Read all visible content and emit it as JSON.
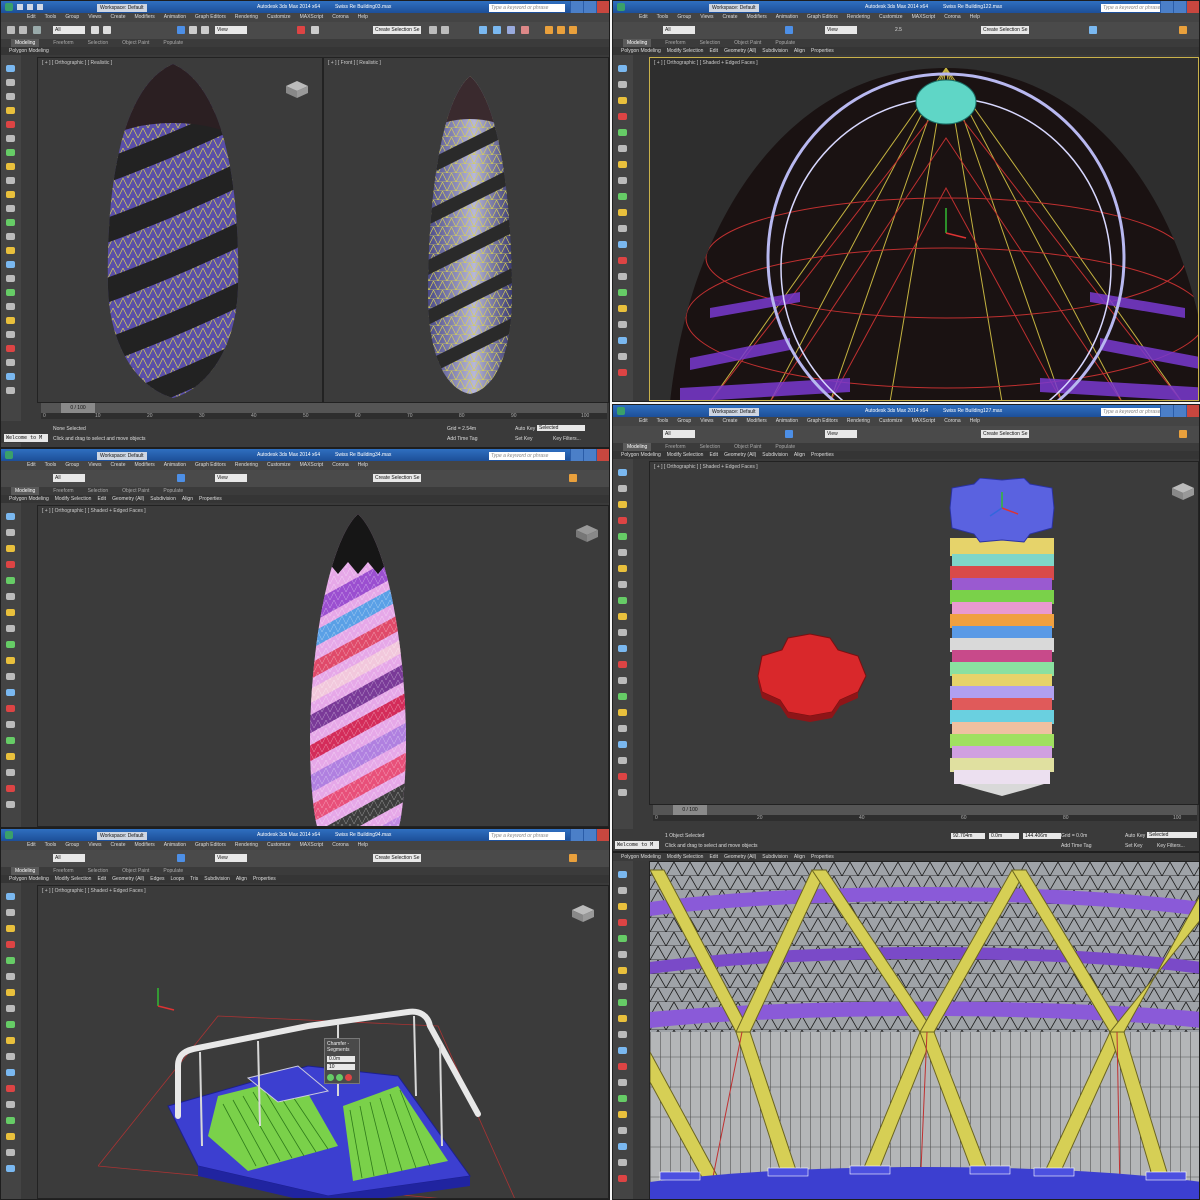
{
  "app": {
    "title": "Autodesk 3ds Max 2014 x64",
    "workspace": "Workspace: Default",
    "search_placeholder": "Type a keyword or phrase"
  },
  "menu": [
    "Edit",
    "Tools",
    "Group",
    "Views",
    "Create",
    "Modifiers",
    "Animation",
    "Graph Editors",
    "Rendering",
    "Customize",
    "MAXScript",
    "Corona",
    "Help"
  ],
  "toolbar": {
    "filter_all": "All",
    "view": "View",
    "create_selection_set": "Create Selection Se",
    "snap": "2.5"
  },
  "ribbon": {
    "tabs": [
      "Modeling",
      "Freeform",
      "Selection",
      "Object Paint",
      "Populate"
    ],
    "sub_default": [
      "Polygon Modeling",
      "Modify Selection",
      "Edit",
      "Geometry (All)",
      "Subdivision",
      "Align",
      "Properties"
    ],
    "sub_edges": [
      "Polygon Modeling",
      "Modify Selection",
      "Edit",
      "Geometry (All)",
      "Edges",
      "Loops",
      "Tris",
      "Subdivision",
      "Align",
      "Properties"
    ]
  },
  "panels": {
    "tl": {
      "file": "Swiss Re Building03.max",
      "vp_left": "[ + ] [ Orthographic ] [ Realistic ]",
      "vp_right": "[ + ] [ Front ] [ Realistic ]",
      "frame": "0 / 100",
      "status_selected": "None Selected",
      "prompt": "Click and drag to select and move objects",
      "grid": "Grid = 2.54m",
      "autokey": "Auto Key",
      "selected": "Selected",
      "setkey": "Set Key",
      "keyfilters": "Key Filters...",
      "add_time_tag": "Add Time Tag",
      "maxscript": "Welcome to M"
    },
    "tr": {
      "file": "Swiss Re Building122.max",
      "vp": "[ + ] [ Orthographic ] [ Shaded + Edged Faces ]"
    },
    "ml": {
      "file": "Swiss Re Building34.max",
      "vp": "[ + ] [ Orthographic ] [ Shaded + Edged Faces ]"
    },
    "mr": {
      "file": "Swiss Re Building127.max",
      "vp": "[ + ] [ Orthographic ] [ Shaded + Edged Faces ]",
      "frame": "0 / 100",
      "status_selected": "1 Object Selected",
      "prompt": "Click and drag to select and move objects",
      "x": "92.704m",
      "y": "0.0m",
      "z": "144.406m",
      "grid": "Grid = 0.0m",
      "autokey": "Auto Key",
      "selected": "Selected",
      "setkey": "Set Key",
      "keyfilters": "Key Filters...",
      "add_time_tag": "Add Time Tag",
      "maxscript": "Welcome to M"
    },
    "bl": {
      "file": "Swiss Re Building94.max",
      "vp": "[ + ] [ Orthographic ] [ Shaded + Edged Faces ]",
      "caddy_title": "Chamfer - Segments",
      "caddy_value": "0.0m",
      "caddy_count": "10"
    },
    "br": {}
  },
  "ruler_ticks": [
    "0",
    "5",
    "10",
    "15",
    "20",
    "25",
    "30",
    "35",
    "40",
    "45",
    "50",
    "55",
    "60",
    "65",
    "70",
    "75",
    "80",
    "85",
    "90",
    "95",
    "100"
  ],
  "colors": {
    "title_blue": "#2563b0",
    "viewport_gray": "#3b3b3b",
    "active_border": "#c9b14a",
    "diagrid_yellow": "#d6cf55",
    "glass_purple": "#6a52c8",
    "floor_green": "#7ad14a",
    "slab_blue": "#3c3fd0",
    "red_plan": "#d9282b"
  }
}
